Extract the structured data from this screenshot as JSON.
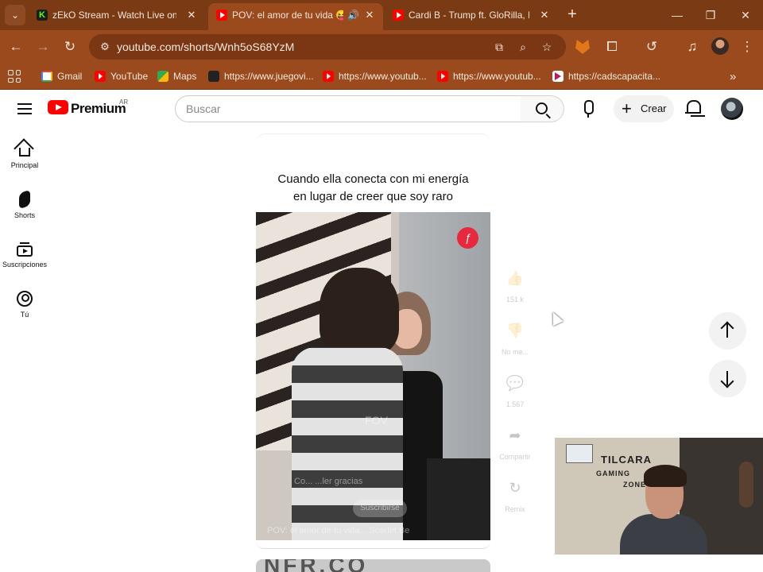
{
  "browser": {
    "tabs": [
      {
        "title": "zEkO Stream - Watch Live on Ki",
        "favicon": "kick-icon",
        "active": false
      },
      {
        "title": "POV: el amor de tu vida 😝",
        "favicon": "youtube-icon",
        "active": true,
        "audio": true
      },
      {
        "title": "Cardi B - Trump ft. GloRilla, Latt",
        "favicon": "youtube-icon",
        "active": false
      }
    ],
    "url": "youtube.com/shorts/Wnh5oS68YzM",
    "bookmarks": [
      {
        "label": "Gmail",
        "icon": "google-icon"
      },
      {
        "label": "YouTube",
        "icon": "youtube-icon"
      },
      {
        "label": "Maps",
        "icon": "maps-icon"
      },
      {
        "label": "https://www.juegovi...",
        "icon": "site-icon"
      },
      {
        "label": "https://www.youtub...",
        "icon": "youtube-icon"
      },
      {
        "label": "https://www.youtub...",
        "icon": "youtube-icon"
      },
      {
        "label": "https://cadscapacita...",
        "icon": "cads-icon"
      }
    ],
    "colors": {
      "frame": "#7a3a14",
      "toolbar": "#9a4a1d"
    }
  },
  "youtube": {
    "brand": "Premium",
    "region": "AR",
    "search_placeholder": "Buscar",
    "create_label": "Crear",
    "rail": [
      {
        "label": "Principal",
        "icon": "home-icon"
      },
      {
        "label": "Shorts",
        "icon": "shorts-icon"
      },
      {
        "label": "Suscripciones",
        "icon": "subscriptions-icon"
      },
      {
        "label": "Tú",
        "icon": "you-icon"
      }
    ],
    "short": {
      "caption_line1": "Cuando ella conecta con mi energía",
      "caption_line2": "en lugar de creer que soy raro",
      "channel_text": "Co... ...ler gracias",
      "subscribe_label": "Suscribirse",
      "title_overlay": "POV: el amor de tu vida... Scarlet Be",
      "watermark": "FOV"
    },
    "actions": [
      {
        "icon": "like-icon",
        "label": "151 k"
      },
      {
        "icon": "dislike-icon",
        "label": "No me..."
      },
      {
        "icon": "comment-icon",
        "label": "1.567"
      },
      {
        "icon": "share-icon",
        "label": "Compartir"
      },
      {
        "icon": "remix-icon",
        "label": "Remix"
      }
    ],
    "next_preview_text": "NFR.CO"
  },
  "webcam": {
    "sign_line1": "TILCARA",
    "sign_line2": "GAMING",
    "sign_line3": "ZONE"
  }
}
